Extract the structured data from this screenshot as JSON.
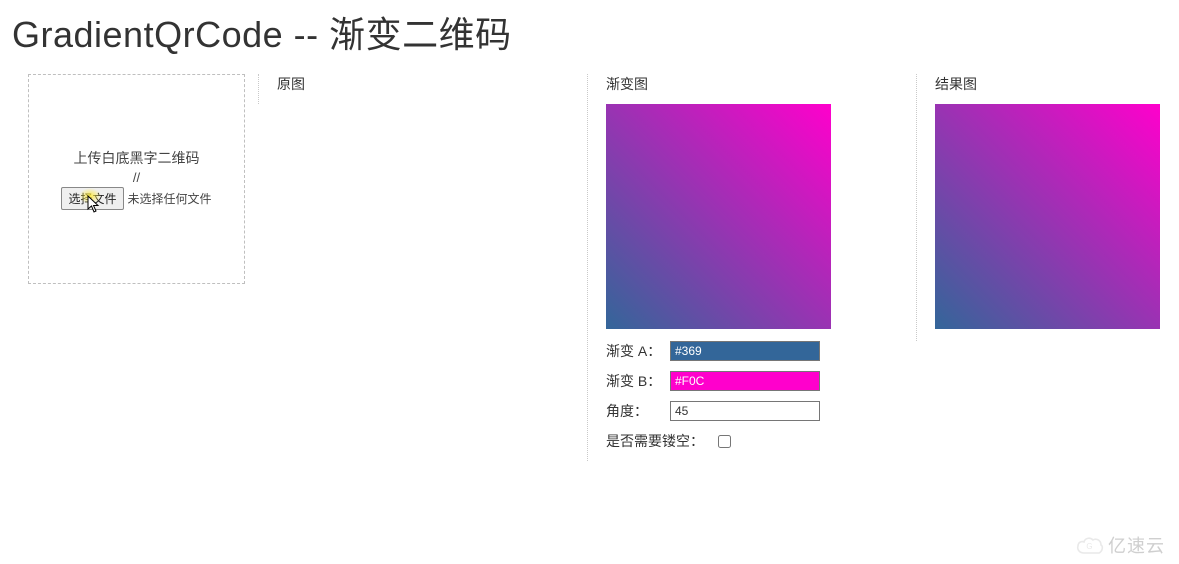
{
  "page": {
    "title": "GradientQrCode -- 渐变二维码"
  },
  "upload": {
    "label": "上传白底黑字二维码",
    "slashes": "//",
    "button_label": "选择文件",
    "status_text": "未选择任何文件"
  },
  "sections": {
    "original": {
      "label": "原图"
    },
    "gradient": {
      "label": "渐变图"
    },
    "result": {
      "label": "结果图"
    }
  },
  "controls": {
    "color_a": {
      "label": "渐变 A：",
      "value": "#369"
    },
    "color_b": {
      "label": "渐变 B：",
      "value": "#F0C"
    },
    "angle": {
      "label": "角度：",
      "value": "45"
    },
    "hollow": {
      "label": "是否需要镂空：",
      "checked": false
    }
  },
  "gradient_css": {
    "angle_deg": 45,
    "from": "#336699",
    "to": "#ff00cc"
  },
  "watermark": {
    "text": "亿速云"
  }
}
